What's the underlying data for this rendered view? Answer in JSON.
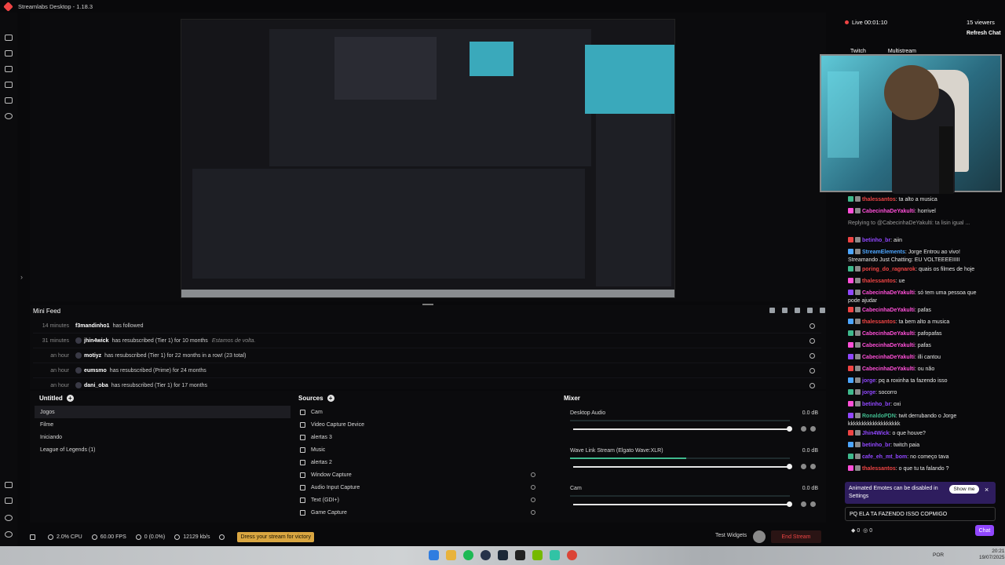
{
  "window": {
    "title": "Streamlabs Desktop - 1.18.3"
  },
  "minifeed": {
    "title": "Mini Feed",
    "events": [
      {
        "time": "14 minutes",
        "user": "f3mandinho1",
        "message": "has followed",
        "extra": ""
      },
      {
        "time": "31 minutes",
        "user": "jhin4wick",
        "message": "has resubscribed (Tier 1) for 10 months",
        "extra": "Estamos de volta."
      },
      {
        "time": "an hour",
        "user": "motiyz",
        "message": "has resubscribed (Tier 1) for 22 months in a row! (23 total)",
        "extra": ""
      },
      {
        "time": "an hour",
        "user": "eumsmo",
        "message": "has resubscribed (Prime) for 24 months",
        "extra": ""
      },
      {
        "time": "an hour",
        "user": "dani_oba",
        "message": "has resubscribed (Tier 1) for 17 months",
        "extra": ""
      }
    ]
  },
  "scenes": {
    "title": "Untitled",
    "items": [
      "Jogos",
      "Filme",
      "Iniciando",
      "League of Legends (1)"
    ]
  },
  "sources": {
    "title": "Sources",
    "items": [
      "Cam",
      "Video Capture Device",
      "alertas 3",
      "Music",
      "alertas 2",
      "Window Capture",
      "Audio Input Capture",
      "Text (GDI+)",
      "Game Capture"
    ]
  },
  "mixer": {
    "title": "Mixer",
    "items": [
      {
        "name": "Desktop Audio",
        "db": "0.0 dB",
        "level": 0
      },
      {
        "name": "Wave Link Stream (Elgato Wave:XLR)",
        "db": "0.0 dB",
        "level": 0.53
      },
      {
        "name": "Cam",
        "db": "0.0 dB",
        "level": 0
      }
    ]
  },
  "statusbar": {
    "cpu": "2.0% CPU",
    "fps": "60.00 FPS",
    "dropped": "0 (0.0%)",
    "bitrate": "12129 kb/s",
    "dress": "Dress your stream for victory",
    "test_widgets": "Test Widgets",
    "end_stream": "End Stream"
  },
  "live": {
    "status": "Live 00:01:10",
    "viewers": "15 viewers",
    "refresh": "Refresh Chat",
    "tab_twitch": "Twitch",
    "tab_multistream": "Multistream"
  },
  "chat": {
    "messages": [
      {
        "user": "thalessantos",
        "text": ": ta alto a musica",
        "color": "#ef4444"
      },
      {
        "user": "CabecinhaDeYakulti",
        "text": ": horrivel",
        "color": "#ff4fd8"
      },
      {
        "user": "",
        "text": "Replying to @CabecinhaDeYakulti: ta lisin igual ...",
        "color": "#9a9a9a"
      },
      {
        "user": "betinho_br",
        "text": ": aiin",
        "color": "#9147ff"
      },
      {
        "user": "StreamElements",
        "text": ": Jorge Entrou ao vivo! Streamando Just Chatting: EU VOLTEEEEIIIII",
        "color": "#4da6ff"
      },
      {
        "user": "poring_do_ragnarok",
        "text": ": quais os filmes de hoje",
        "color": "#ef4444"
      },
      {
        "user": "thalessantos",
        "text": ": ue",
        "color": "#ef4444"
      },
      {
        "user": "CabecinhaDeYakulti",
        "text": ": só tem uma pessoa que pode ajudar",
        "color": "#ff4fd8"
      },
      {
        "user": "CabecinhaDeYakulti",
        "text": ": pafas",
        "color": "#ff4fd8"
      },
      {
        "user": "thalessantos",
        "text": ": ta bem alto a musica",
        "color": "#ef4444"
      },
      {
        "user": "CabecinhaDeYakulti",
        "text": ": pafopafas",
        "color": "#ff4fd8"
      },
      {
        "user": "CabecinhaDeYakulti",
        "text": ": pafas",
        "color": "#ff4fd8"
      },
      {
        "user": "CabecinhaDeYakulti",
        "text": ": illi cantou",
        "color": "#ff4fd8"
      },
      {
        "user": "CabecinhaDeYakulti",
        "text": ": ou não",
        "color": "#ff4fd8"
      },
      {
        "user": "jorge",
        "text": ": pq a roxinha ta fazendo isso",
        "color": "#9147ff"
      },
      {
        "user": "jorge",
        "text": ": socorro",
        "color": "#9147ff"
      },
      {
        "user": "betinho_br",
        "text": ": oxi",
        "color": "#9147ff"
      },
      {
        "user": "RonaldoPDN",
        "text": ": twit derrubando o Jorge kkkkkkkkkkkkkkkkkkk",
        "color": "#3fb98d"
      },
      {
        "user": "Jhin4Wick",
        "text": ": o que houve?",
        "color": "#9147ff"
      },
      {
        "user": "betinho_br",
        "text": ": twitch paia",
        "color": "#9147ff"
      },
      {
        "user": "cafe_eh_mt_bom",
        "text": ": no começo tava",
        "color": "#9147ff"
      },
      {
        "user": "thalessantos",
        "text": ": o que tu ta falando ?",
        "color": "#ef4444"
      }
    ],
    "banner": "Animated Emotes can be disabled in Settings",
    "show_me": "Show me",
    "input_value": "PQ ELA TA FAZENDO ISSO COPMIGO",
    "points": "0",
    "bits": "0",
    "chat_button": "Chat"
  },
  "taskbar": {
    "lang": "POR",
    "time": "20:21",
    "date": "19/07/2025"
  },
  "colors": {
    "accent": "#9147ff",
    "live": "#ef4444",
    "level": "#3fb98d",
    "dress": "#d9a641"
  }
}
